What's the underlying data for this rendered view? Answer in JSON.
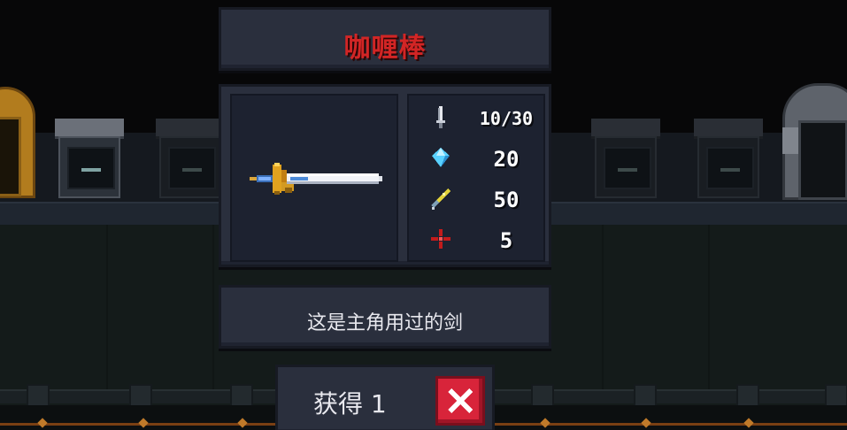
{
  "item": {
    "name": "咖喱棒",
    "description": "这是主角用过的剑"
  },
  "stats": [
    {
      "icon": "dagger-icon",
      "label_hidden": "",
      "value": "10/30"
    },
    {
      "icon": "blue-crystal-energy-icon",
      "value": "20"
    },
    {
      "icon": "critical-syringe-icon",
      "value": "50"
    },
    {
      "icon": "red-crosshair-icon",
      "value": "5"
    }
  ],
  "obtain": {
    "label": "获得 1"
  },
  "colors": {
    "title_red": "#d22525",
    "panel": "#2a2f3d",
    "panel_inner": "#1d2230",
    "close_red": "#d8243a",
    "crystal_blue": "#59d1ff"
  }
}
